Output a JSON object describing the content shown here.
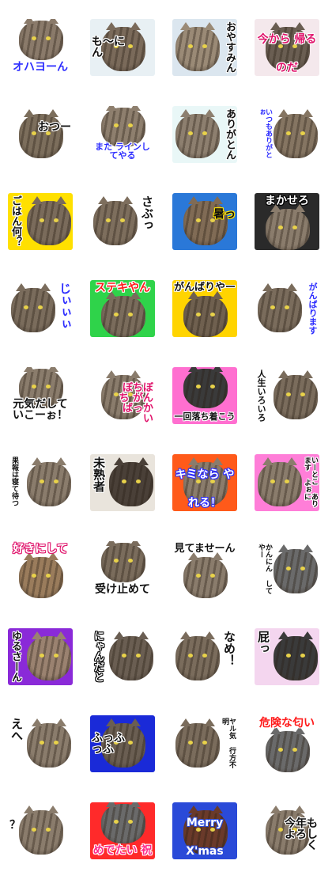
{
  "stickers": [
    {
      "text": "オハヨーん",
      "bg": "#ffffff",
      "cat": "#8a7a6a",
      "color": "#2d2dff",
      "stroke": "#ffffff",
      "vertical": false,
      "pos": "bottom"
    },
    {
      "text": "も〜にん",
      "bg": "#e8f0f4",
      "cat": "#7a6a5a",
      "color": "#111111",
      "stroke": "#ffffff",
      "vertical": false,
      "pos": "left"
    },
    {
      "text": "おやすみん",
      "bg": "#dbe6ef",
      "cat": "#9a8a76",
      "color": "#111111",
      "stroke": "#ffffff",
      "vertical": true,
      "pos": "right"
    },
    {
      "text": "今から 帰るのだ",
      "bg": "#f4e8ec",
      "cat": "#6a5e52",
      "color": "#e0136b",
      "stroke": "#ffffff",
      "vertical": false,
      "pos": "split"
    },
    {
      "text": "おつー",
      "bg": "#ffffff",
      "cat": "#7c6e5c",
      "color": "#111111",
      "stroke": "#ffffff",
      "vertical": false,
      "pos": "right"
    },
    {
      "text": "また ラインしてやる",
      "bg": "#ffffff",
      "cat": "#8e7f6e",
      "color": "#2d2dff",
      "stroke": "#ffffff",
      "vertical": false,
      "pos": "bottom"
    },
    {
      "text": "ありがとん",
      "bg": "#e9f7f7",
      "cat": "#8d7f6f",
      "color": "#111111",
      "stroke": "#ffffff",
      "vertical": true,
      "pos": "right"
    },
    {
      "text": "いつもありがとぉ",
      "bg": "#ffffff",
      "cat": "#857562",
      "color": "#2d2dff",
      "stroke": "#ffffff",
      "vertical": true,
      "pos": "left"
    },
    {
      "text": "ごはん何？",
      "bg": "#ffe000",
      "cat": "#7a6b5b",
      "color": "#111111",
      "stroke": "#ffffff",
      "vertical": true,
      "pos": "left"
    },
    {
      "text": "さぶっ",
      "bg": "#ffffff",
      "cat": "#7d6e5d",
      "color": "#111111",
      "stroke": "#ffffff",
      "vertical": true,
      "pos": "right"
    },
    {
      "text": "暑っ",
      "bg": "#2a78d8",
      "cat": "#806b55",
      "color": "#111111",
      "stroke": "#ffe400",
      "vertical": false,
      "pos": "right"
    },
    {
      "text": "まかせろ",
      "bg": "#2a2a2a",
      "cat": "#8a7c6c",
      "color": "#ffffff",
      "stroke": "#000000",
      "vertical": false,
      "pos": "top"
    },
    {
      "text": "じぃぃぃ",
      "bg": "#ffffff",
      "cat": "#7a6c5c",
      "color": "#2d2dff",
      "stroke": "#ffffff",
      "vertical": true,
      "pos": "right"
    },
    {
      "text": "ステキやん",
      "bg": "#2fd34a",
      "cat": "#7a6c5c",
      "color": "#ff1a1a",
      "stroke": "#ffffff",
      "vertical": false,
      "pos": "top"
    },
    {
      "text": "がんばりやー",
      "bg": "#ffd400",
      "cat": "#6f604f",
      "color": "#111111",
      "stroke": "#ffffff",
      "vertical": false,
      "pos": "top"
    },
    {
      "text": "がんばります",
      "bg": "#ffffff",
      "cat": "#7a6c5c",
      "color": "#2d2dff",
      "stroke": "#ffffff",
      "vertical": true,
      "pos": "right"
    },
    {
      "text": "元気だして いこーぉ！",
      "bg": "#ffffff",
      "cat": "#8a7c6c",
      "color": "#111111",
      "stroke": "#ffffff",
      "vertical": false,
      "pos": "bottom"
    },
    {
      "text": "ぼちぼち がんばっかい",
      "bg": "#ffffff",
      "cat": "#8a7c6c",
      "color": "#e0136b",
      "stroke": "#ffffff",
      "vertical": false,
      "pos": "right"
    },
    {
      "text": "一回落ち着こう",
      "bg": "#ff6fd0",
      "cat": "#3a3a3a",
      "color": "#111111",
      "stroke": "#ffffff",
      "vertical": false,
      "pos": "bottom"
    },
    {
      "text": "人生いろいろ",
      "bg": "#ffffff",
      "cat": "#7a6c5c",
      "color": "#111111",
      "stroke": "#ffffff",
      "vertical": true,
      "pos": "left"
    },
    {
      "text": "果報は寝て待つ",
      "bg": "#ffffff",
      "cat": "#8a7c6c",
      "color": "#111111",
      "stroke": "#ffffff",
      "vertical": true,
      "pos": "left"
    },
    {
      "text": "未熟者",
      "bg": "#e9e4dc",
      "cat": "#4a4038",
      "color": "#111111",
      "stroke": "#ffffff",
      "vertical": true,
      "pos": "left"
    },
    {
      "text": "キミなら やれる！",
      "bg": "#ff5a1a",
      "cat": "#8a7c6c",
      "color": "#ffffff",
      "stroke": "#2d2dff",
      "vertical": false,
      "pos": "split"
    },
    {
      "text": "いーとこ あります よぉに",
      "bg": "#ff7ed8",
      "cat": "#8a7c6c",
      "color": "#111111",
      "stroke": "#ffffff",
      "vertical": true,
      "pos": "right"
    },
    {
      "text": "好きにして",
      "bg": "#ffffff",
      "cat": "#9a7c5c",
      "color": "#ffffff",
      "stroke": "#e0136b",
      "vertical": false,
      "pos": "top"
    },
    {
      "text": "受け止めて",
      "bg": "#ffffff",
      "cat": "#7a6c5c",
      "color": "#111111",
      "stroke": "#ffffff",
      "vertical": false,
      "pos": "bottom"
    },
    {
      "text": "見てませーん",
      "bg": "#ffffff",
      "cat": "#8a7c6c",
      "color": "#111111",
      "stroke": "#ffffff",
      "vertical": false,
      "pos": "top"
    },
    {
      "text": "かんにん してやー",
      "bg": "#ffffff",
      "cat": "#6a6a6a",
      "color": "#111111",
      "stroke": "#ffffff",
      "vertical": true,
      "pos": "left"
    },
    {
      "text": "ゆるさーん",
      "bg": "#8a2ad8",
      "cat": "#9a8270",
      "color": "#111111",
      "stroke": "#ffffff",
      "vertical": true,
      "pos": "left"
    },
    {
      "text": "にゃんだと",
      "bg": "#ffffff",
      "cat": "#6a5e52",
      "color": "#ffffff",
      "stroke": "#000000",
      "vertical": true,
      "pos": "left"
    },
    {
      "text": "なめ！",
      "bg": "#ffffff",
      "cat": "#7a6c5c",
      "color": "#111111",
      "stroke": "#ffffff",
      "vertical": true,
      "pos": "right"
    },
    {
      "text": "屁っ",
      "bg": "#f4d6ef",
      "cat": "#3a3a3a",
      "color": "#111111",
      "stroke": "#ffffff",
      "vertical": true,
      "pos": "left"
    },
    {
      "text": "えへ",
      "bg": "#ffffff",
      "cat": "#8a7c6c",
      "color": "#111111",
      "stroke": "#ffffff",
      "vertical": true,
      "pos": "left"
    },
    {
      "text": "ふっふっふ",
      "bg": "#1a2ad8",
      "cat": "#6a5e52",
      "color": "#111111",
      "stroke": "#ffffff",
      "vertical": false,
      "pos": "left"
    },
    {
      "text": "ヤル気 行方不明",
      "bg": "#ffffff",
      "cat": "#7a6c5c",
      "color": "#111111",
      "stroke": "#ffffff",
      "vertical": true,
      "pos": "right"
    },
    {
      "text": "危険な匂い",
      "bg": "#ffffff",
      "cat": "#6a6a6a",
      "color": "#ff1a1a",
      "stroke": "#ffffff",
      "vertical": false,
      "pos": "top"
    },
    {
      "text": "？",
      "bg": "#ffffff",
      "cat": "#8a7c6c",
      "color": "#111111",
      "stroke": "#ffffff",
      "vertical": false,
      "pos": "left"
    },
    {
      "text": "めでたい 祝",
      "bg": "#ff2a2a",
      "cat": "#6a6a6a",
      "color": "#ff2a8a",
      "stroke": "#ffffff",
      "vertical": false,
      "pos": "bottom"
    },
    {
      "text": "Merry X'mas",
      "bg": "#2a4ad8",
      "cat": "#6a3a2a",
      "color": "#ffffff",
      "stroke": "#2a4ad8",
      "vertical": false,
      "pos": "split"
    },
    {
      "text": "今年も よろしく",
      "bg": "#ffffff",
      "cat": "#8a7c6c",
      "color": "#111111",
      "stroke": "#ffffff",
      "vertical": false,
      "pos": "right"
    }
  ]
}
